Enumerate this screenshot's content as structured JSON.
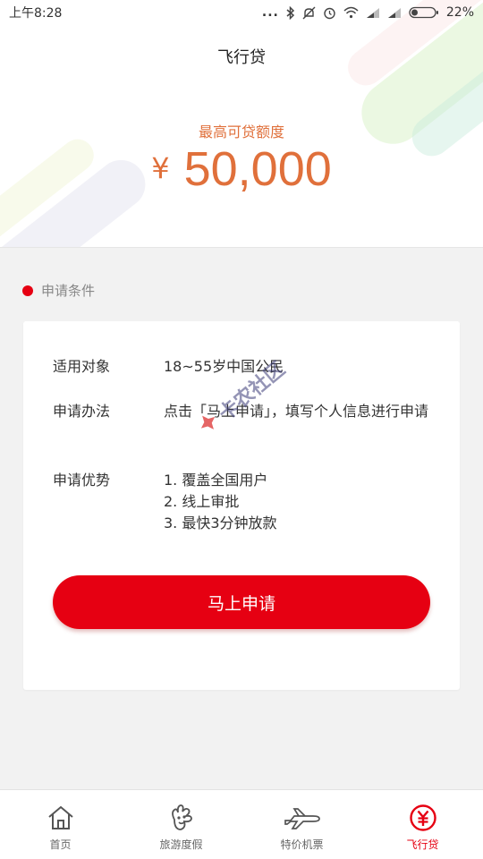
{
  "status_bar": {
    "time": "上午8:28",
    "dots": "...",
    "battery": "22%"
  },
  "app": {
    "title": "飞行贷"
  },
  "limit": {
    "label": "最高可贷额度",
    "currency": "¥",
    "amount": "50,000"
  },
  "section": {
    "title": "申请条件"
  },
  "conditions": {
    "target_label": "适用对象",
    "target_value": "18~55岁中国公民",
    "method_label": "申请办法",
    "method_value": "点击「马上申请」，填写个人信息进行申请",
    "advantage_label": "申请优势",
    "advantages": [
      "1. 覆盖全国用户",
      "2. 线上审批",
      "3. 最快3分钟放款"
    ]
  },
  "apply_button": {
    "label": "马上申请"
  },
  "watermark": {
    "text": "卡农社区"
  },
  "bottom_nav": {
    "items": [
      {
        "label": "首页",
        "icon": "home-icon"
      },
      {
        "label": "旅游度假",
        "icon": "travel-icon"
      },
      {
        "label": "特价机票",
        "icon": "airplane-icon"
      },
      {
        "label": "飞行贷",
        "icon": "yuan-icon"
      }
    ],
    "active_index": 3
  },
  "colors": {
    "accent": "#e60012",
    "amount": "#e0703b"
  }
}
